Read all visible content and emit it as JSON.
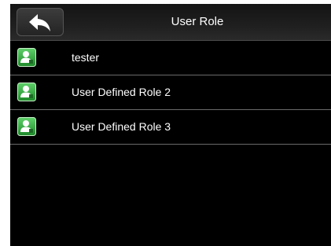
{
  "header": {
    "title": "User Role",
    "back_icon": "back-arrow-icon"
  },
  "roles": [
    {
      "label": "tester",
      "icon": "user-role-icon"
    },
    {
      "label": "User Defined Role 2",
      "icon": "user-role-icon"
    },
    {
      "label": "User Defined Role 3",
      "icon": "user-role-icon"
    }
  ],
  "colors": {
    "screen_background": "#000000",
    "icon_green": "#2aa836",
    "text": "#ffffff"
  }
}
